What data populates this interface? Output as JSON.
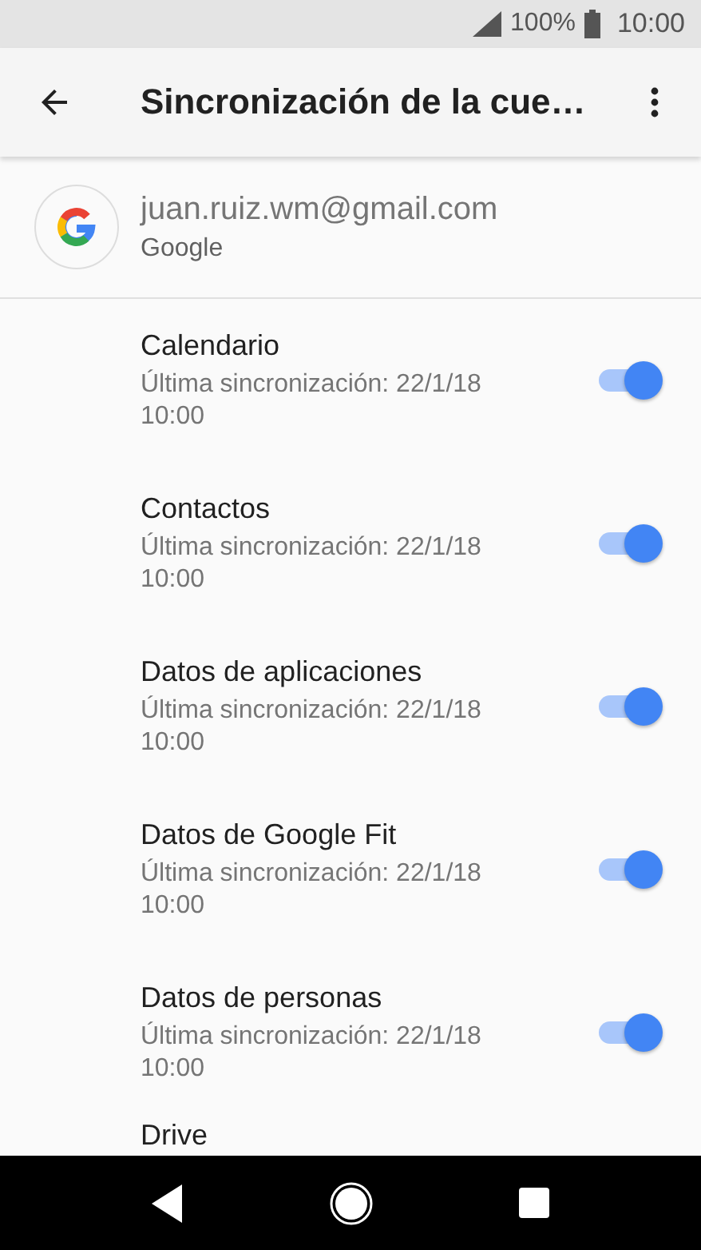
{
  "status_bar": {
    "battery": "100%",
    "time": "10:00"
  },
  "toolbar": {
    "title": "Sincronización de la cue…"
  },
  "account": {
    "email": "juan.ruiz.wm@gmail.com",
    "type": "Google"
  },
  "sync_items": [
    {
      "title": "Calendario",
      "subtitle": "Última sincronización: 22/1/18 10:00",
      "on": true
    },
    {
      "title": "Contactos",
      "subtitle": "Última sincronización: 22/1/18 10:00",
      "on": true
    },
    {
      "title": "Datos de aplicaciones",
      "subtitle": "Última sincronización: 22/1/18 10:00",
      "on": true
    },
    {
      "title": "Datos de Google Fit",
      "subtitle": "Última sincronización: 22/1/18 10:00",
      "on": true
    },
    {
      "title": "Datos de personas",
      "subtitle": "Última sincronización: 22/1/18 10:00",
      "on": true
    },
    {
      "title": "Drive"
    }
  ]
}
